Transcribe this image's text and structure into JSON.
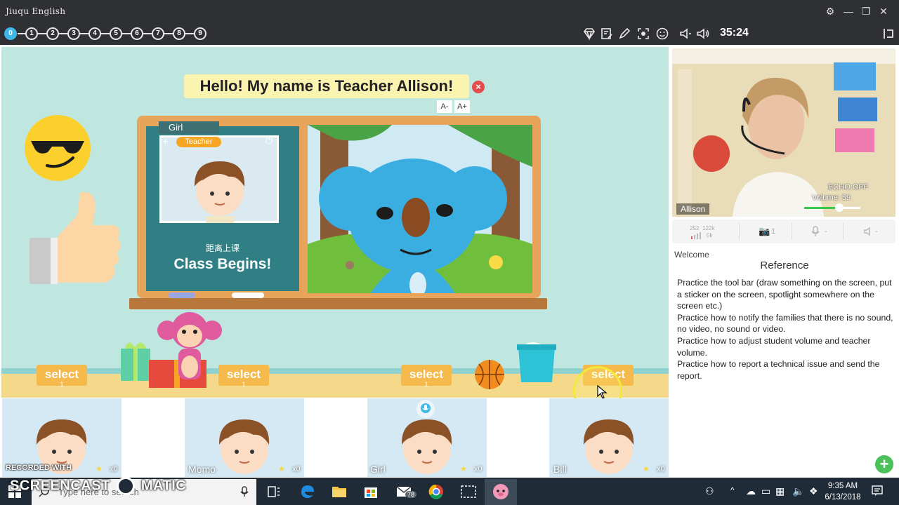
{
  "window": {
    "title": "Jiuqu English"
  },
  "toolbar": {
    "steps": [
      "0",
      "1",
      "2",
      "3",
      "4",
      "5",
      "6",
      "7",
      "8",
      "9"
    ],
    "timer": "35:24"
  },
  "stage": {
    "hello_text": "Hello! My name is Teacher Allison!",
    "font_decrease": "A-",
    "font_increase": "A+",
    "teacher_panel": {
      "name": "Girl",
      "badge": "Teacher",
      "countdown_label": "距离上课",
      "status": "Class Begins!"
    },
    "select_buttons": [
      {
        "label": "select",
        "count": "1"
      },
      {
        "label": "select",
        "count": "1"
      },
      {
        "label": "select",
        "count": "1"
      },
      {
        "label": "select",
        "count": ""
      }
    ]
  },
  "webcam": {
    "name": "Allison",
    "echo": "ECHO:OFF",
    "volume_label": "Volume: 59",
    "volume_level": 59,
    "stats": {
      "upload": "252",
      "download": "122k",
      "lost": "0k",
      "cameras": "1",
      "mic": "-",
      "speaker": "-"
    }
  },
  "reference": {
    "welcome": "Welcome",
    "title": "Reference",
    "lines": [
      "Practice the tool bar (draw something on the screen, put a sticker on the screen, spotlight somewhere on the screen etc.)",
      "Practice how to notify the families that there is no sound, no video, no sound or video.",
      "Practice how to adjust student volume and teacher volume.",
      "Practice how to report a technical issue and send the report."
    ]
  },
  "students": [
    {
      "name": "",
      "stars": "x0"
    },
    {
      "name": "Momo",
      "stars": "x0"
    },
    {
      "name": "Girl",
      "stars": "x0"
    },
    {
      "name": "Bill",
      "stars": "x0"
    }
  ],
  "taskbar": {
    "search_placeholder": "Type here to search",
    "mail_badge": "78",
    "time": "9:35 AM",
    "date": "6/13/2018"
  },
  "watermark": {
    "line1": "RECORDED WITH",
    "line2": "SCREENCAST",
    "line3": "MATIC"
  },
  "colors": {
    "accent": "#3fb8e8",
    "select": "#f6b94b",
    "stage": "#bfe7e0",
    "add": "#4cc15a"
  }
}
